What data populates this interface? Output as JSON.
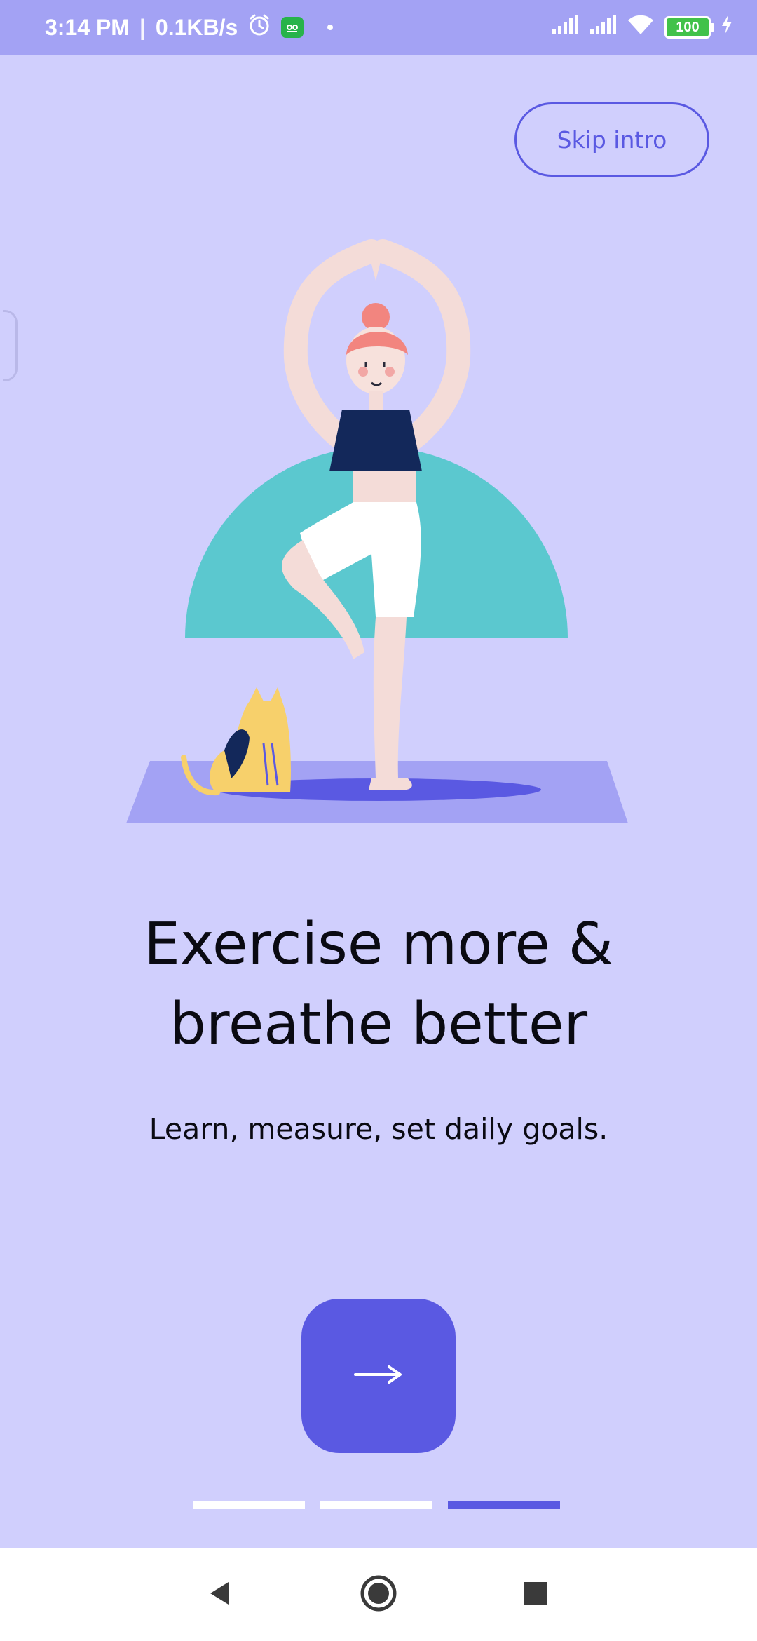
{
  "status_bar": {
    "time": "3:14 PM",
    "net_speed": "0.1KB/s",
    "battery": "100",
    "icons": [
      "alarm-icon",
      "app-badge-icon",
      "signal-icon",
      "signal-icon",
      "wifi-icon",
      "battery-icon",
      "charging-icon"
    ]
  },
  "skip_label": "Skip intro",
  "headline_line1": "Exercise more &",
  "headline_line2": "breathe better",
  "subtitle": "Learn, measure, set daily goals.",
  "next_icon": "arrow-right-icon",
  "pager": {
    "total": 3,
    "active_index": 2
  },
  "colors": {
    "background": "#d0cffd",
    "status_bar": "#a3a2f4",
    "accent": "#5a59e2",
    "teal": "#5bc8cf",
    "mat": "#a3a2f4"
  }
}
